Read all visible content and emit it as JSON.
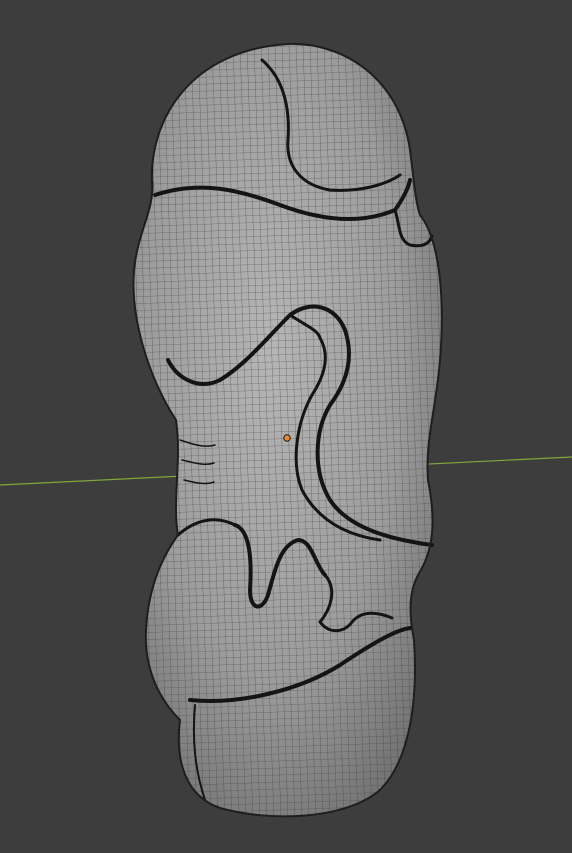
{
  "viewport": {
    "background_color": "#3d3d3d",
    "grid_axis_color": "#7fa83a",
    "mesh_fill_color": "#9a9a9a",
    "mesh_wire_color": "#3a3a3a",
    "mesh_outline_color": "#1e1e1e",
    "groove_color": "#141414",
    "origin_color": "#f08a24"
  },
  "scene": {
    "object": "sculpted-sole-mesh",
    "display_mode": "wireframe-overlay",
    "axis_shown": "x-axis"
  }
}
